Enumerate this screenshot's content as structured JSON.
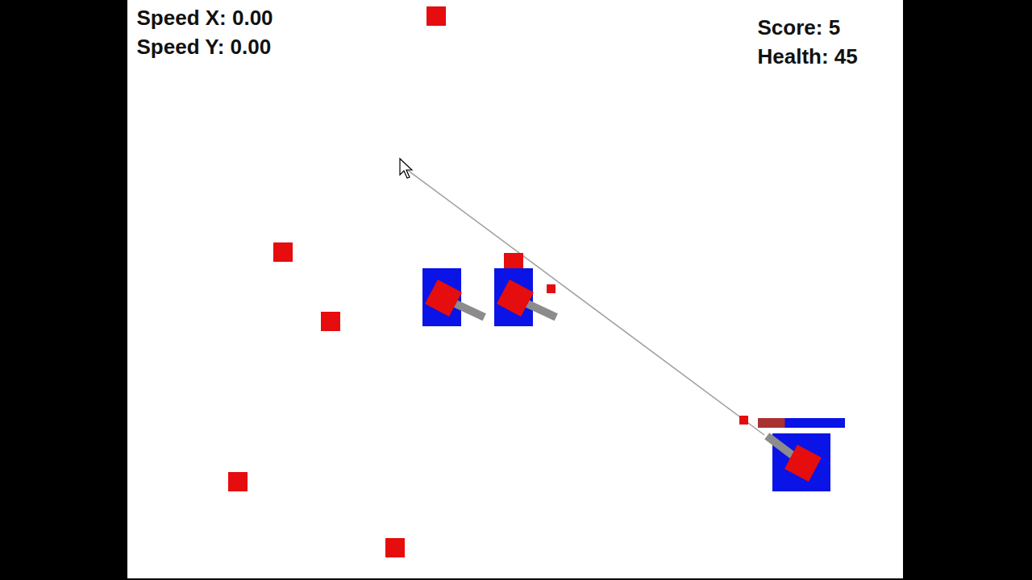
{
  "hud": {
    "speed_x": "Speed X: 0.00",
    "speed_y": "Speed Y: 0.00",
    "score": "Score: 5",
    "health": "Health: 45"
  },
  "player": {
    "health_bar": {
      "level": 0.69
    }
  },
  "enemies": [
    {
      "kind": "tank"
    },
    {
      "kind": "tank"
    }
  ],
  "objects": [
    {
      "kind": "block"
    },
    {
      "kind": "block"
    },
    {
      "kind": "block"
    },
    {
      "kind": "block"
    },
    {
      "kind": "block"
    },
    {
      "kind": "block"
    },
    {
      "kind": "bullet"
    },
    {
      "kind": "bullet"
    }
  ]
}
